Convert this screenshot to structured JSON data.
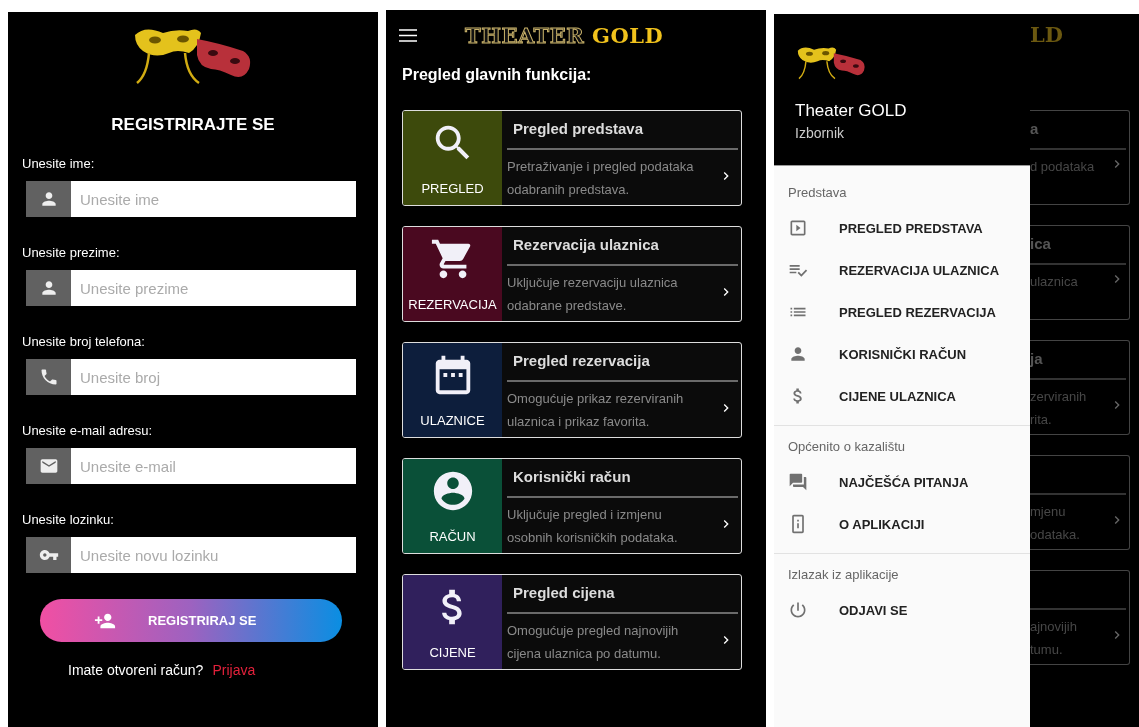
{
  "registration_screen": {
    "title": "REGISTRIRAJTE SE",
    "fields": [
      {
        "label": "Unesite ime:",
        "placeholder": "Unesite ime"
      },
      {
        "label": "Unesite prezime:",
        "placeholder": "Unesite prezime"
      },
      {
        "label": "Unesite broj telefona:",
        "placeholder": "Unesite broj"
      },
      {
        "label": "Unesite e-mail adresu:",
        "placeholder": "Unesite e-mail"
      },
      {
        "label": "Unesite lozinku:",
        "placeholder": "Unesite novu lozinku"
      }
    ],
    "register_button": "REGISTRIRAJ SE",
    "login_prompt": "Imate otvoreni račun?",
    "login_link": "Prijava"
  },
  "home_screen": {
    "logo": {
      "outline_text": "THEATER",
      "gold_text": "GOLD"
    },
    "heading": "Pregled glavnih funkcija:",
    "cards": [
      {
        "tile_label": "PREGLED",
        "title": "Pregled predstava",
        "description": "Pretraživanje i pregled podataka odabranih predstava.",
        "color": "#3d4a0c"
      },
      {
        "tile_label": "REZERVACIJA",
        "title": "Rezervacija ulaznica",
        "description": "Uključuje rezervaciju ulaznica odabrane predstave.",
        "color": "#4a0920"
      },
      {
        "tile_label": "ULAZNICE",
        "title": "Pregled rezervacija",
        "description": "Omogućuje prikaz rezerviranih ulaznica i prikaz favorita.",
        "color": "#0d1e3c"
      },
      {
        "tile_label": "RAČUN",
        "title": "Korisnički račun",
        "description": "Uključuje pregled i izmjenu osobnih korisničkih podataka.",
        "color": "#0a5038"
      },
      {
        "tile_label": "CIJENE",
        "title": "Pregled cijena",
        "description": "Omogućuje pregled najnovijih cijena ulaznica po datumu.",
        "color": "#30205c"
      }
    ]
  },
  "drawer_screen": {
    "app_title": "Theater GOLD",
    "subtitle": "Izbornik",
    "sections": [
      {
        "title": "Predstava",
        "items": [
          "PREGLED PREDSTAVA",
          "REZERVACIJA ULAZNICA",
          "PREGLED REZERVACIJA",
          "KORISNIČKI RAČUN",
          "CIJENE ULAZNICA"
        ]
      },
      {
        "title": "Općenito o kazalištu",
        "items": [
          "NAJČEŠĆA PITANJA",
          "O APLIKACIJI"
        ]
      },
      {
        "title": "Izlazak iz aplikacije",
        "items": [
          "ODJAVI SE"
        ]
      }
    ],
    "background": {
      "logo_fragment": "LD",
      "cards": [
        {
          "title": "a",
          "lines": [
            "d podataka"
          ]
        },
        {
          "title": "ica",
          "lines": [
            "ulaznica"
          ]
        },
        {
          "title": "ja",
          "lines": [
            "zerviranih",
            "rita."
          ]
        },
        {
          "lines": [
            "mjenu",
            "odataka."
          ]
        },
        {
          "lines": [
            "ajnovijih",
            "tumu."
          ]
        }
      ]
    }
  }
}
